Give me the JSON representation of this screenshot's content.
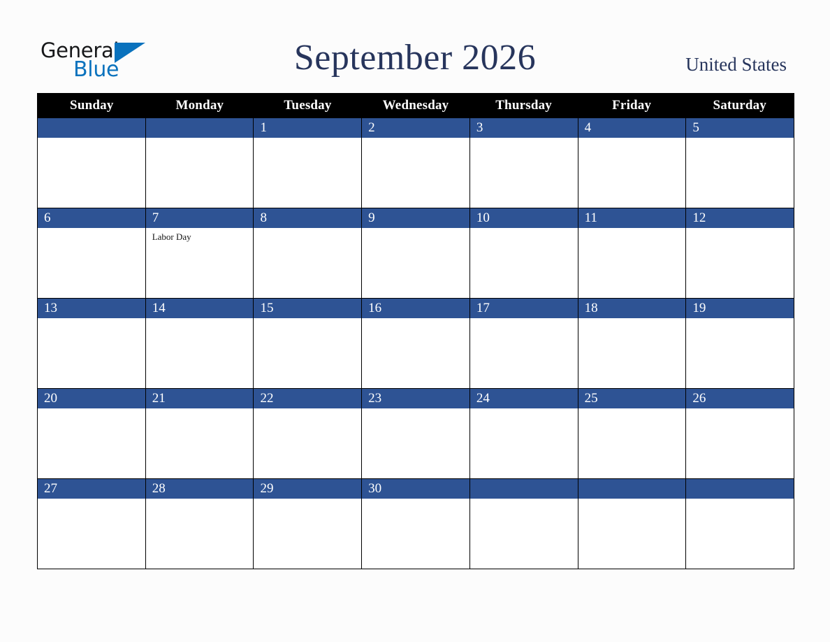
{
  "brand": {
    "name_part1": "General",
    "name_part2": "Blue",
    "triangle_color": "#0a72bd",
    "text_color": "#17181a"
  },
  "header": {
    "title": "September 2026",
    "country": "United States",
    "title_color": "#27355c"
  },
  "colors": {
    "weekday_header_bg": "#000000",
    "weekday_header_text": "#ffffff",
    "date_band_bg": "#2e5394",
    "date_band_text": "#ffffff",
    "cell_bg": "#ffffff",
    "grid_line": "#000000",
    "page_bg": "#fcfcfc"
  },
  "weekdays": [
    "Sunday",
    "Monday",
    "Tuesday",
    "Wednesday",
    "Thursday",
    "Friday",
    "Saturday"
  ],
  "weeks": [
    {
      "days": [
        {
          "num": "",
          "events": []
        },
        {
          "num": "",
          "events": []
        },
        {
          "num": "1",
          "events": []
        },
        {
          "num": "2",
          "events": []
        },
        {
          "num": "3",
          "events": []
        },
        {
          "num": "4",
          "events": []
        },
        {
          "num": "5",
          "events": []
        }
      ]
    },
    {
      "days": [
        {
          "num": "6",
          "events": []
        },
        {
          "num": "7",
          "events": [
            "Labor Day"
          ]
        },
        {
          "num": "8",
          "events": []
        },
        {
          "num": "9",
          "events": []
        },
        {
          "num": "10",
          "events": []
        },
        {
          "num": "11",
          "events": []
        },
        {
          "num": "12",
          "events": []
        }
      ]
    },
    {
      "days": [
        {
          "num": "13",
          "events": []
        },
        {
          "num": "14",
          "events": []
        },
        {
          "num": "15",
          "events": []
        },
        {
          "num": "16",
          "events": []
        },
        {
          "num": "17",
          "events": []
        },
        {
          "num": "18",
          "events": []
        },
        {
          "num": "19",
          "events": []
        }
      ]
    },
    {
      "days": [
        {
          "num": "20",
          "events": []
        },
        {
          "num": "21",
          "events": []
        },
        {
          "num": "22",
          "events": []
        },
        {
          "num": "23",
          "events": []
        },
        {
          "num": "24",
          "events": []
        },
        {
          "num": "25",
          "events": []
        },
        {
          "num": "26",
          "events": []
        }
      ]
    },
    {
      "days": [
        {
          "num": "27",
          "events": []
        },
        {
          "num": "28",
          "events": []
        },
        {
          "num": "29",
          "events": []
        },
        {
          "num": "30",
          "events": []
        },
        {
          "num": "",
          "events": []
        },
        {
          "num": "",
          "events": []
        },
        {
          "num": "",
          "events": []
        }
      ]
    }
  ]
}
